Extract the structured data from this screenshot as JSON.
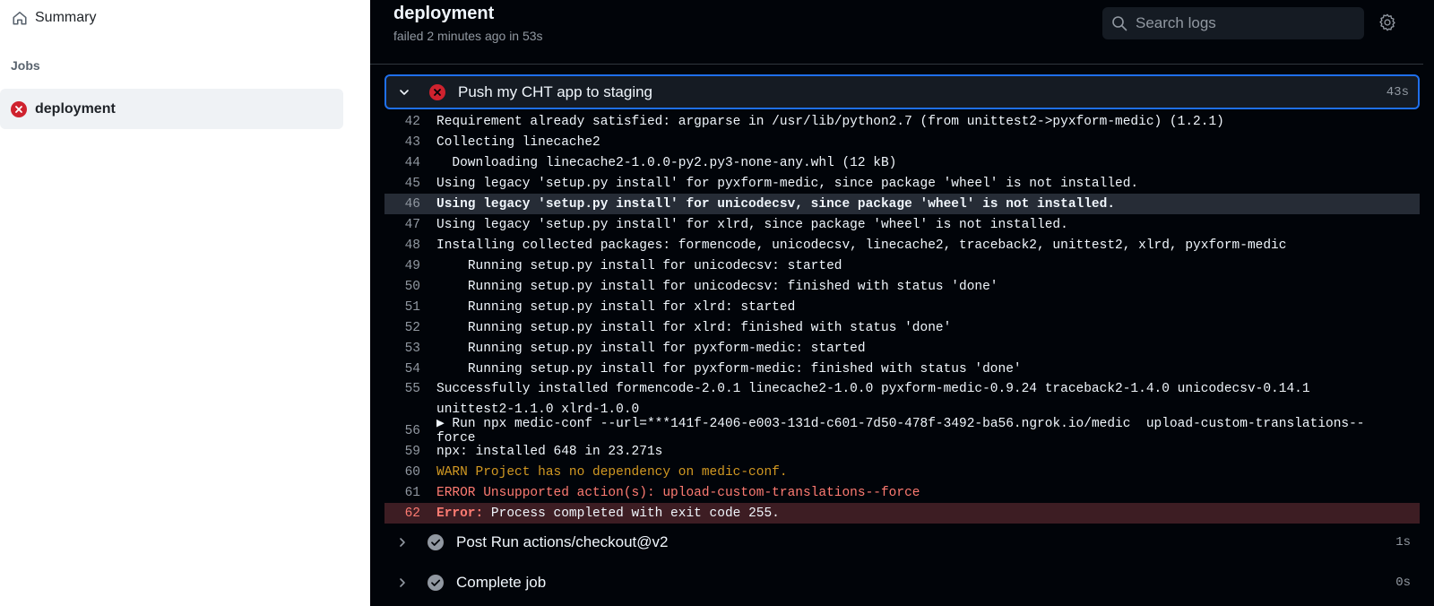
{
  "sidebar": {
    "summary_label": "Summary",
    "section_label": "Jobs",
    "job_label": "deployment"
  },
  "header": {
    "job_title": "deployment",
    "job_status": "failed 2 minutes ago in 53s",
    "search_placeholder": "Search logs"
  },
  "steps": [
    {
      "name": "Push my CHT app to staging",
      "time": "43s",
      "status": "failed",
      "expanded": true
    },
    {
      "name": "Post Run actions/checkout@v2",
      "time": "1s",
      "status": "success",
      "expanded": false
    },
    {
      "name": "Complete job",
      "time": "0s",
      "status": "success",
      "expanded": false
    }
  ],
  "log_lines": [
    {
      "n": "42",
      "t": "Requirement already satisfied: argparse in /usr/lib/python2.7 (from unittest2->pyxform-medic) (1.2.1)"
    },
    {
      "n": "43",
      "t": "Collecting linecache2"
    },
    {
      "n": "44",
      "t": "  Downloading linecache2-1.0.0-py2.py3-none-any.whl (12 kB)"
    },
    {
      "n": "45",
      "t": "Using legacy 'setup.py install' for pyxform-medic, since package 'wheel' is not installed."
    },
    {
      "n": "46",
      "t": "Using legacy 'setup.py install' for unicodecsv, since package 'wheel' is not installed."
    },
    {
      "n": "47",
      "t": "Using legacy 'setup.py install' for xlrd, since package 'wheel' is not installed."
    },
    {
      "n": "48",
      "t": "Installing collected packages: formencode, unicodecsv, linecache2, traceback2, unittest2, xlrd, pyxform-medic"
    },
    {
      "n": "49",
      "t": "    Running setup.py install for unicodecsv: started"
    },
    {
      "n": "50",
      "t": "    Running setup.py install for unicodecsv: finished with status 'done'"
    },
    {
      "n": "51",
      "t": "    Running setup.py install for xlrd: started"
    },
    {
      "n": "52",
      "t": "    Running setup.py install for xlrd: finished with status 'done'"
    },
    {
      "n": "53",
      "t": "    Running setup.py install for pyxform-medic: started"
    },
    {
      "n": "54",
      "t": "    Running setup.py install for pyxform-medic: finished with status 'done'"
    },
    {
      "n": "55",
      "t": "Successfully installed formencode-2.0.1 linecache2-1.0.0 pyxform-medic-0.9.24 traceback2-1.4.0 unicodecsv-0.14.1 unittest2-1.1.0 xlrd-1.0.0"
    },
    {
      "n": "56",
      "t": "▶ Run npx medic-conf --url=***141f-2406-e003-131d-c601-7d50-478f-3492-ba56.ngrok.io/medic  upload-custom-translations--force"
    },
    {
      "n": "59",
      "t": "npx: installed 648 in 23.271s"
    },
    {
      "n": "60",
      "t": "WARN Project has no dependency on medic-conf."
    },
    {
      "n": "61",
      "t": "ERROR Unsupported action(s): upload-custom-translations--force"
    },
    {
      "n": "62",
      "prefix": "Error:",
      "t": " Process completed with exit code 255."
    }
  ],
  "colors": {
    "accent": "#1f6feb",
    "error": "#cf222e",
    "warn": "#d29922",
    "log_background": "#010409"
  }
}
